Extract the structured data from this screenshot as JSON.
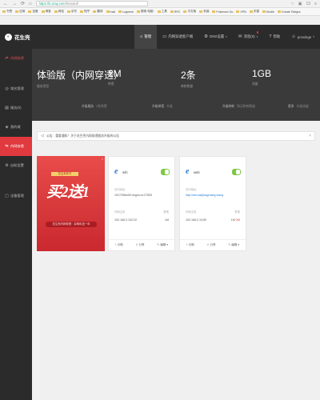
{
  "browser": {
    "url_host": "https://b.oray.com",
    "url_path": "/forward/",
    "tab_count": "13"
  },
  "bookmarks": [
    "书签",
    "应用",
    "百度",
    "淘宝",
    "网站",
    "京东",
    "知乎",
    "翻译",
    "mail",
    "Logmein",
    "搜索·电脑·",
    "工具",
    "RPC",
    "中文版",
    "安装",
    "Pokemon Go",
    "VPN",
    "天猫",
    "Kindle",
    "Create Telegra"
  ],
  "header": {
    "logo_text": "花生壳",
    "nav": [
      {
        "label": "管理",
        "icon": "home-icon"
      },
      {
        "label": "内网穿透客户端",
        "icon": "monitor-icon"
      },
      {
        "label": "DNS设置",
        "icon": "dns-icon"
      },
      {
        "label": "消息(0)",
        "icon": "bell-icon"
      },
      {
        "label": "帮助",
        "icon": "help-icon"
      },
      {
        "label": "pcsxinge",
        "icon": "user-icon"
      }
    ]
  },
  "sidebar": {
    "items": [
      {
        "label": "内网穿透",
        "icon": "arrow-icon",
        "style": "red"
      },
      {
        "label": "域名管理",
        "icon": "globe-icon",
        "style": ""
      },
      {
        "label": "服务(0)",
        "icon": "server-icon",
        "style": ""
      },
      {
        "label": "我的域",
        "icon": "domain-icon",
        "style": ""
      },
      {
        "label": "内网穿透",
        "icon": "map-icon",
        "style": "active"
      },
      {
        "label": "自助设置",
        "icon": "settings-icon",
        "style": ""
      },
      {
        "label": "设备管理",
        "icon": "device-icon",
        "style": ""
      }
    ]
  },
  "stats": {
    "items": [
      {
        "value": "体验版（内网穿透）",
        "label": "服务类型"
      },
      {
        "value": "2M",
        "label": "带宽"
      },
      {
        "value": "2条",
        "label": "映射数量"
      },
      {
        "value": "1GB",
        "label": "流量"
      }
    ],
    "links": [
      {
        "text": "升级服务",
        "muted": "2条免费"
      },
      {
        "text": "升级带宽",
        "muted": "升级"
      },
      {
        "text": "升级映射",
        "muted": "购买映射数量"
      },
      {
        "text": "更多",
        "muted": "升级流量"
      }
    ]
  },
  "notice": {
    "text": "公告：重要通知！关于花生壳内网穿透服务升级的公告",
    "close": "×"
  },
  "promo": {
    "tag": "花生壳年付",
    "headline": "买2送1",
    "sub": "花生壳内网穿透 · 买两年送一年",
    "close": "×"
  },
  "cards": [
    {
      "icon_letter": "e",
      "name": "ssh",
      "address_label": "访问地址",
      "address": "1917338m53.imgcs.cn:27553",
      "intranet_label": "内网主机",
      "intranet": "192.168.2.102:22",
      "status_label": "带宽",
      "status": "1M",
      "status_extra": "",
      "link_style": false,
      "actions": [
        "诊断",
        "分享",
        "编辑"
      ]
    },
    {
      "icon_letter": "e",
      "name": "web",
      "address_label": "访问地址",
      "address": "http://ssh.zaijiangzhang.wang",
      "intranet_label": "内网主机",
      "intranet": "192.168.2.10:80",
      "status_label": "带宽",
      "status": "1M",
      "status_extra": "·2M",
      "link_style": true,
      "actions": [
        "诊断",
        "分享",
        "编辑"
      ]
    }
  ]
}
